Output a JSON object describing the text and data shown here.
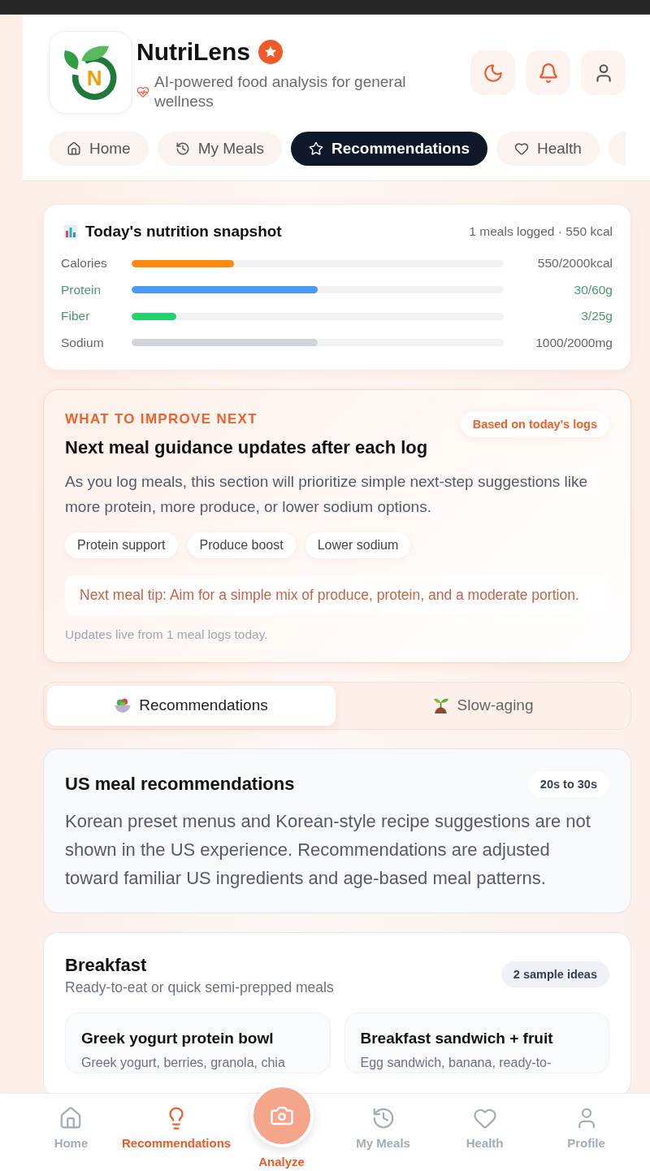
{
  "header": {
    "logo_letter": "N",
    "app_name": "NutriLens",
    "tagline": "AI-powered food analysis for general wellness"
  },
  "nav_tabs": [
    {
      "label": "Home",
      "selected": false
    },
    {
      "label": "My Meals",
      "selected": false
    },
    {
      "label": "Recommendations",
      "selected": true
    },
    {
      "label": "Health",
      "selected": false
    },
    {
      "selected": false
    }
  ],
  "snapshot": {
    "title": "Today's nutrition snapshot",
    "summary": "1 meals logged · 550 kcal",
    "rows": [
      {
        "label": "Calories",
        "value": "550/2000kcal",
        "level": 0.275,
        "color": "#fb8a0e",
        "highlighted": false
      },
      {
        "label": "Protein",
        "value": "30/60g",
        "level": 0.5,
        "color": "#4b9bf6",
        "highlighted": true
      },
      {
        "label": "Fiber",
        "value": "3/25g",
        "level": 0.12,
        "color": "#22d36b",
        "highlighted": true
      },
      {
        "label": "Sodium",
        "value": "1000/2000mg",
        "level": 0.5,
        "color": "#d1d5db",
        "highlighted": false
      }
    ]
  },
  "improve": {
    "eyebrow": "WHAT TO IMPROVE NEXT",
    "badge": "Based on today's logs",
    "title": "Next meal guidance updates after each log",
    "body": "As you log meals, this section will prioritize simple next-step suggestions like more protein, more produce, or lower sodium options.",
    "chips": [
      "Protein support",
      "Produce boost",
      "Lower sodium"
    ],
    "tip": "Next meal tip: Aim for a simple mix of produce, protein, and a moderate portion.",
    "footnote": "Updates live from 1 meal logs today."
  },
  "section_tabs": [
    {
      "label": "Recommendations",
      "selected": true
    },
    {
      "label": "Slow-aging",
      "selected": false
    }
  ],
  "us_card": {
    "title": "US meal recommendations",
    "badge": "20s to 30s",
    "body": "Korean preset menus and Korean-style recipe suggestions are not shown in the US experience. Recommendations are adjusted toward familiar US ingredients and age-based meal patterns."
  },
  "meal_section": {
    "title": "Breakfast",
    "subtitle": "Ready-to-eat or quick semi-prepped meals",
    "badge": "2 sample ideas",
    "meals": [
      {
        "name": "Greek yogurt protein bowl",
        "ingredients": "Greek yogurt, berries, granola, chia"
      },
      {
        "name": "Breakfast sandwich + fruit",
        "ingredients": "Egg sandwich, banana, ready-to-"
      }
    ]
  },
  "bottom_nav": [
    {
      "label": "Home",
      "selected": false,
      "kind": "tab"
    },
    {
      "label": "Recommendations",
      "selected": true,
      "kind": "tab"
    },
    {
      "label": "Analyze",
      "selected": false,
      "kind": "action"
    },
    {
      "label": "My Meals",
      "selected": false,
      "kind": "tab"
    },
    {
      "label": "Health",
      "selected": false,
      "kind": "tab"
    },
    {
      "label": "Profile",
      "selected": false,
      "kind": "tab"
    }
  ]
}
